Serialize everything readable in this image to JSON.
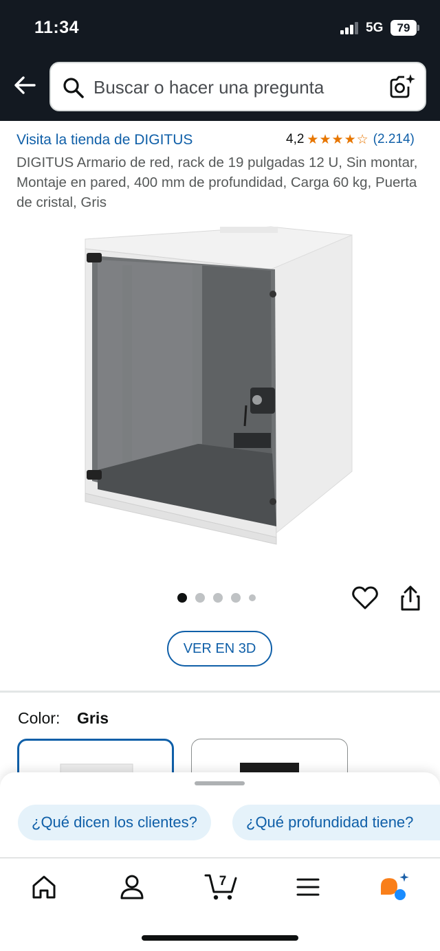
{
  "status_bar": {
    "time": "11:34",
    "network": "5G",
    "battery": "79"
  },
  "search": {
    "placeholder": "Buscar o hacer una pregunta"
  },
  "product": {
    "store_link": "Visita la tienda de DIGITUS",
    "rating_value": "4,2",
    "rating_stars": 4.2,
    "rating_count": "(2.214)",
    "title": "DIGITUS Armario de red, rack de 19 pulgadas 12 U, Sin montar, Montaje en pared, 400 mm de profundidad, Carga 60 kg, Puerta de cristal, Gris"
  },
  "carousel": {
    "image_count": 5,
    "active_index": 0,
    "view_3d_label": "VER EN 3D"
  },
  "color": {
    "label": "Color:",
    "selected": "Gris",
    "options": [
      "Gris",
      "Negro"
    ]
  },
  "suggestions": [
    "¿Qué dicen los clientes?",
    "¿Qué profundidad tiene?"
  ],
  "bottom_nav": {
    "items": [
      "home-icon",
      "account-icon",
      "cart-icon",
      "menu-icon",
      "rufus-icon"
    ],
    "cart_count": "7"
  },
  "colors": {
    "header_bg": "#131921",
    "link": "#0f5fa8",
    "star": "#e77600",
    "chip_bg": "#e5f2fa",
    "rufus_orange": "#f97f1a",
    "rufus_blue": "#1a8cff"
  }
}
